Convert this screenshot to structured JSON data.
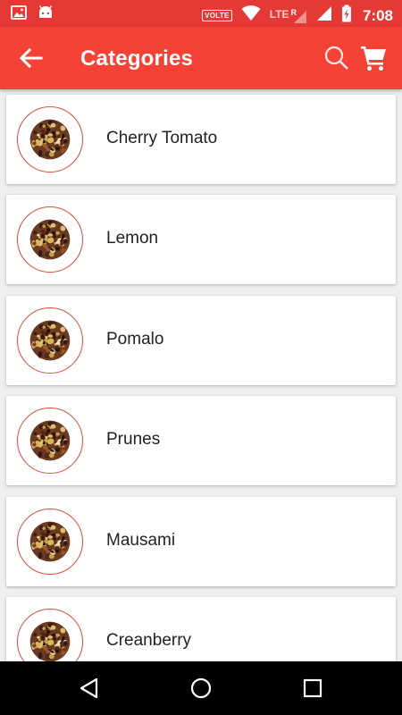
{
  "status_bar": {
    "volte_label": "VOLTE",
    "lte_label": "LTE",
    "roaming_label": "R",
    "time": "7:08"
  },
  "app_bar": {
    "title": "Categories",
    "back_icon": "arrow-left-icon",
    "search_icon": "search-icon",
    "cart_icon": "shopping-cart-icon"
  },
  "categories": [
    {
      "name": "Cherry Tomato"
    },
    {
      "name": "Lemon"
    },
    {
      "name": "Pomalo"
    },
    {
      "name": "Prunes"
    },
    {
      "name": "Mausami"
    },
    {
      "name": "Creanberry"
    }
  ],
  "colors": {
    "app_bar": "#f44336",
    "status_bar": "#e53935",
    "thumb_border": "#d84a3c"
  }
}
